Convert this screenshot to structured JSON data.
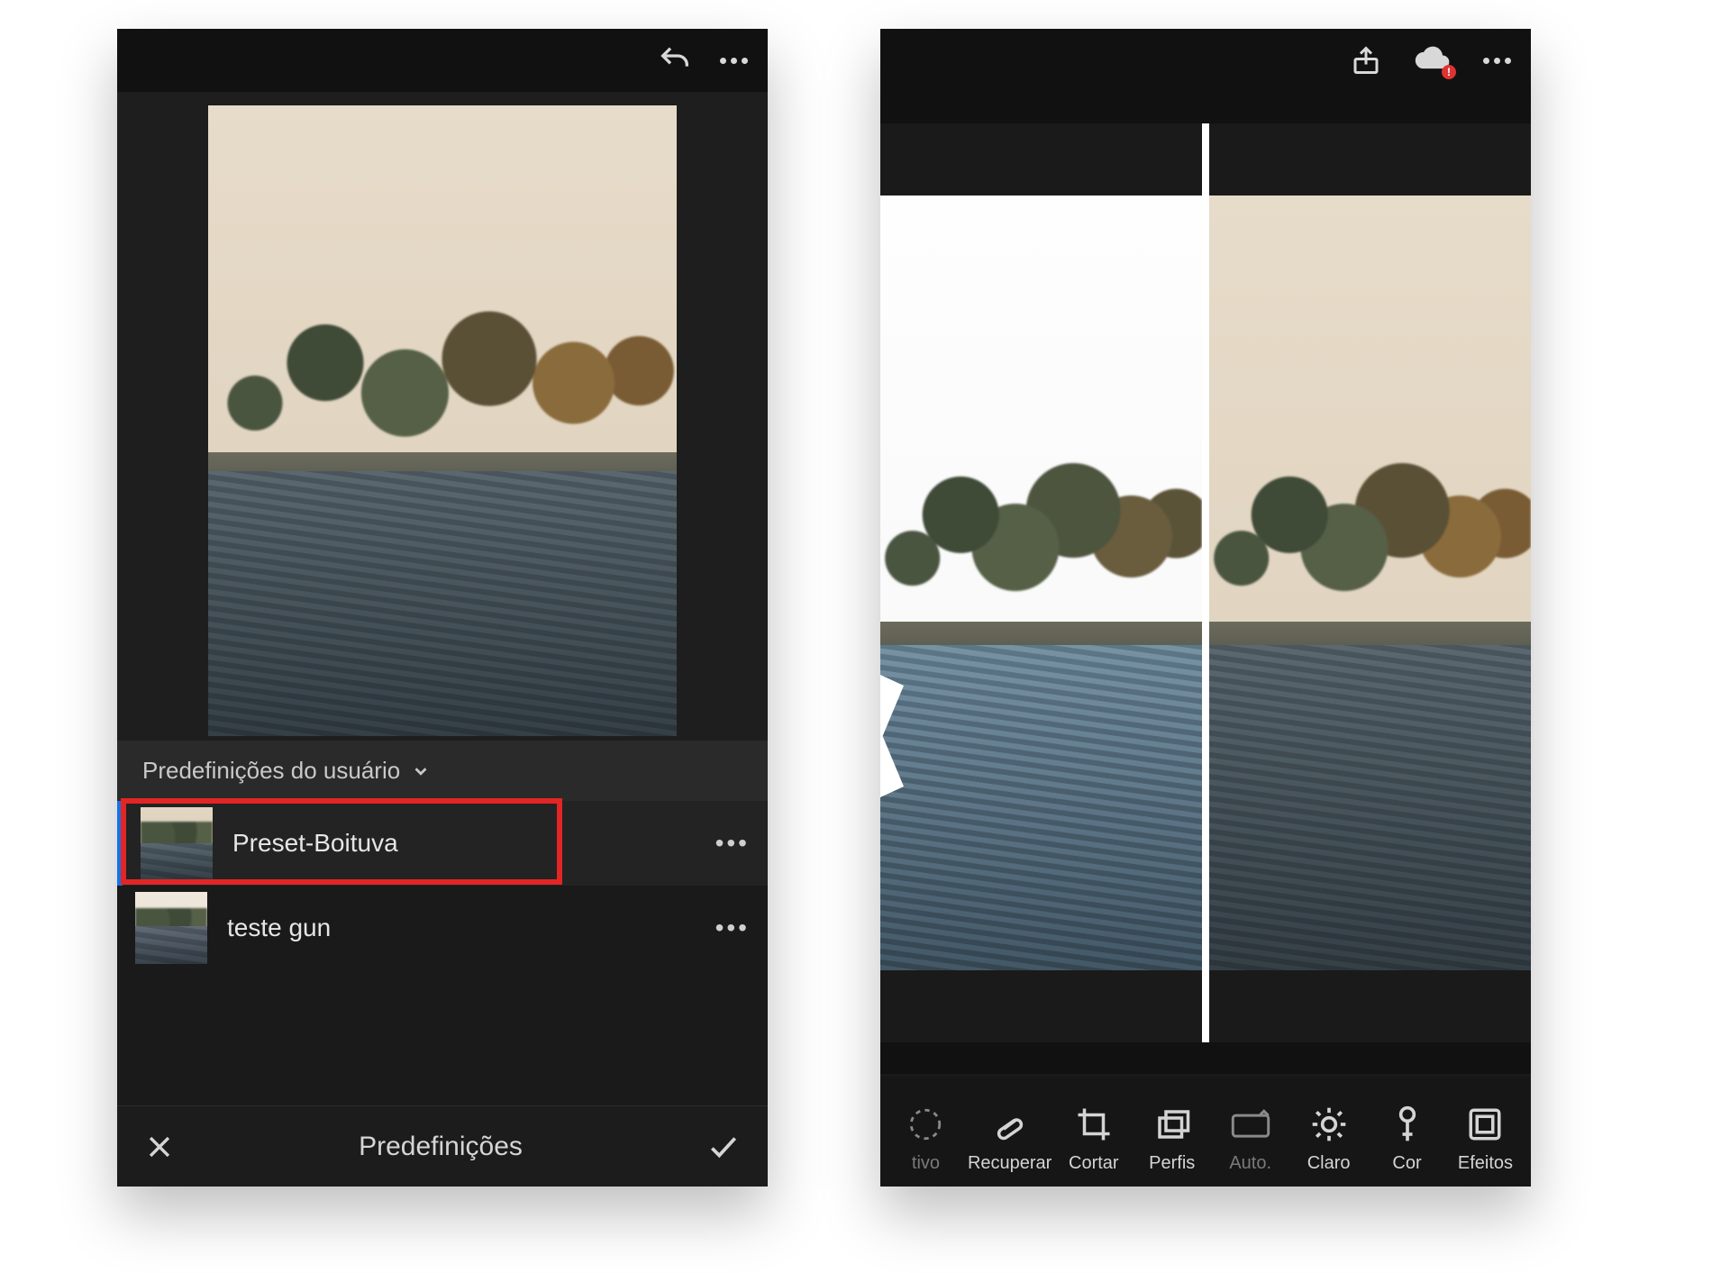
{
  "left": {
    "header": {
      "undo_icon": "undo-icon",
      "more_icon": "more-icon"
    },
    "preset_group_label": "Predefinições do usuário",
    "presets": [
      {
        "name": "Preset-Boituva",
        "selected": true
      },
      {
        "name": "teste gun",
        "selected": false
      }
    ],
    "bottom": {
      "cancel_icon": "close-icon",
      "title": "Predefinições",
      "confirm_icon": "check-icon"
    }
  },
  "right": {
    "header": {
      "share_icon": "share-icon",
      "cloud_icon": "cloud-alert-icon",
      "more_icon": "more-icon"
    },
    "tools": [
      {
        "id": "seletivo",
        "label": "tivo",
        "dim": true
      },
      {
        "id": "recuperar",
        "label": "Recuperar"
      },
      {
        "id": "cortar",
        "label": "Cortar"
      },
      {
        "id": "perfis",
        "label": "Perfis"
      },
      {
        "id": "auto",
        "label": "Auto.",
        "dim": true
      },
      {
        "id": "claro",
        "label": "Claro"
      },
      {
        "id": "cor",
        "label": "Cor"
      },
      {
        "id": "efeitos",
        "label": "Efeitos"
      }
    ]
  }
}
